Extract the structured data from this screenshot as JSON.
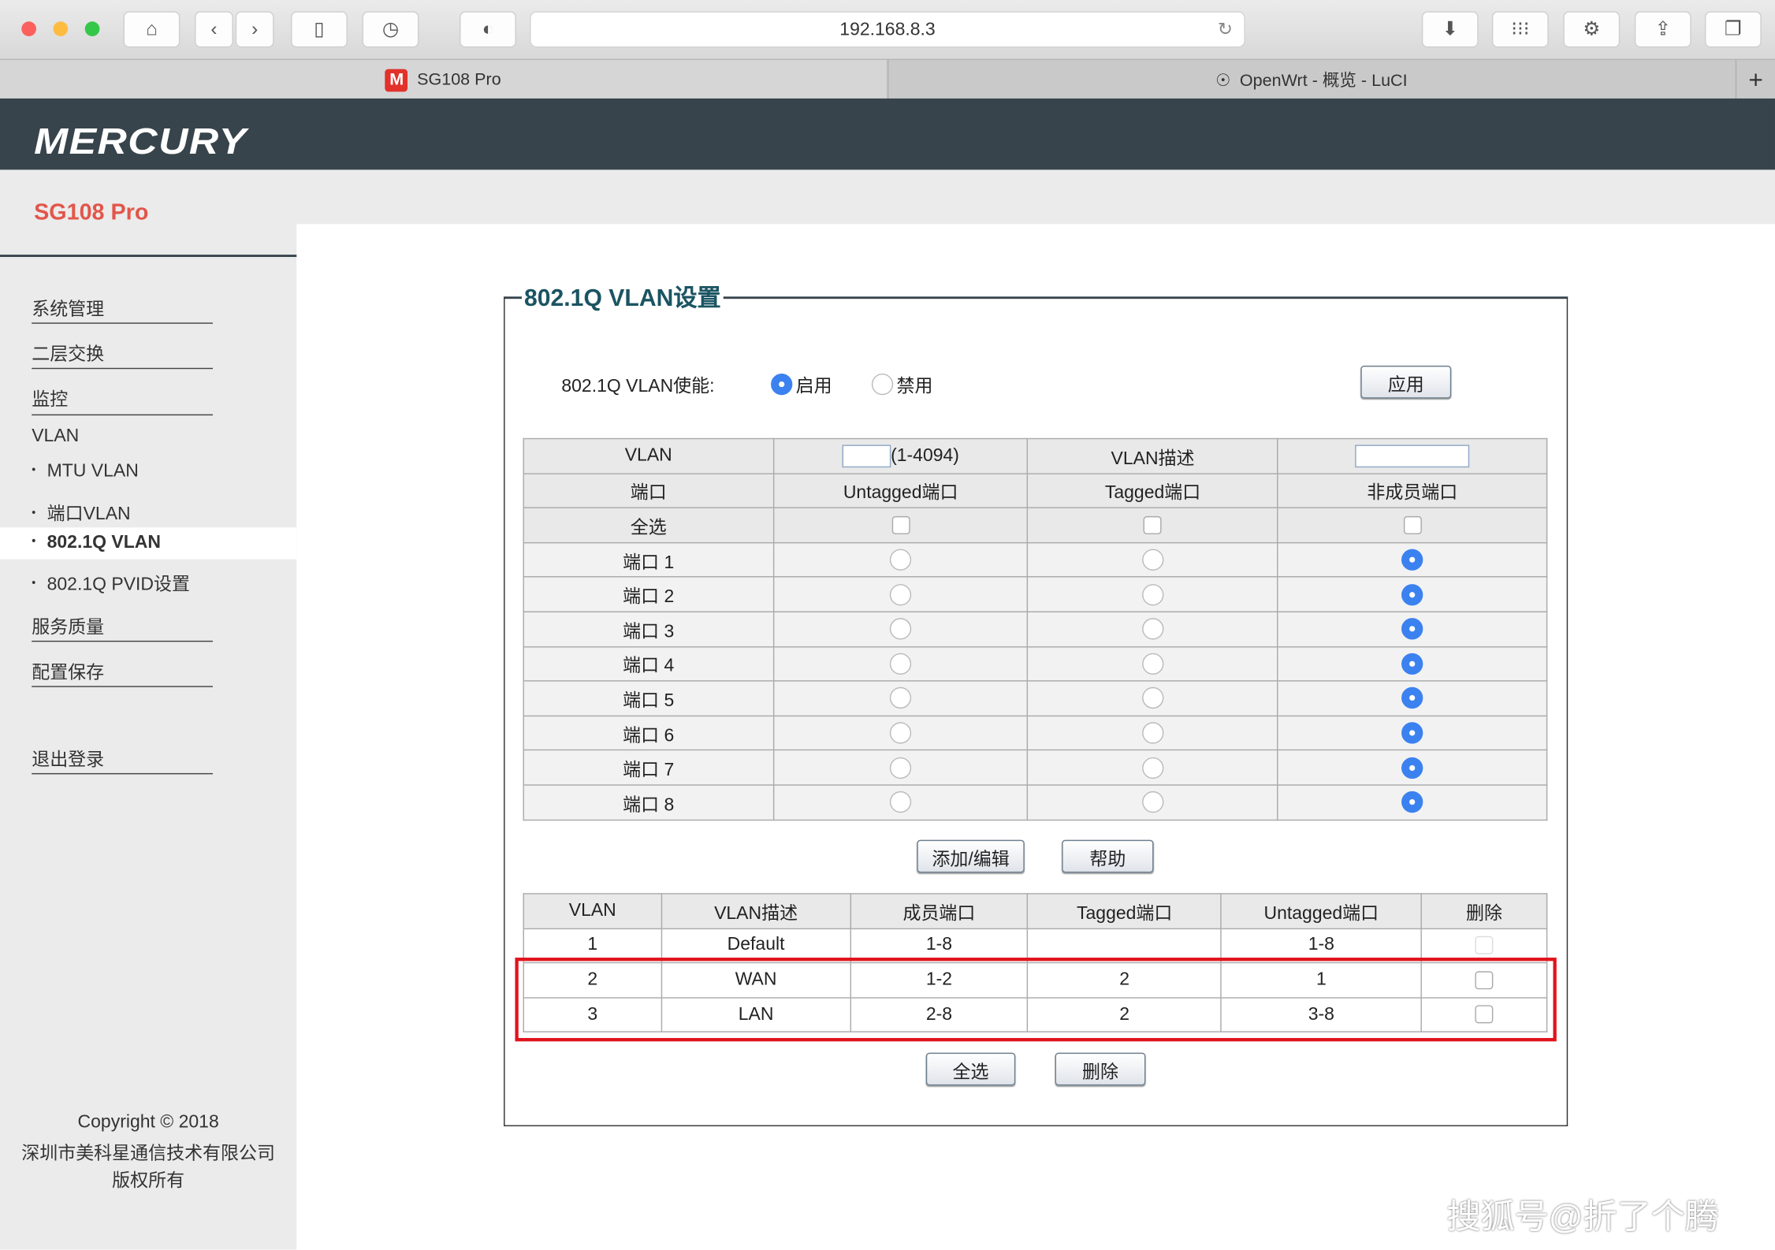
{
  "browser": {
    "url": "192.168.8.3",
    "tabs": [
      {
        "label": "SG108 Pro",
        "active": true
      },
      {
        "label": "OpenWrt - 概览 - LuCI",
        "active": false
      }
    ]
  },
  "header": {
    "logo": "MERCURY",
    "model": "SG108 Pro"
  },
  "sidebar": {
    "items": [
      {
        "label": "系统管理"
      },
      {
        "label": "二层交换"
      },
      {
        "label": "监控"
      },
      {
        "label": "VLAN"
      }
    ],
    "sub": [
      {
        "label": "MTU VLAN"
      },
      {
        "label": "端口VLAN"
      },
      {
        "label": "802.1Q VLAN",
        "active": true
      },
      {
        "label": "802.1Q PVID设置"
      }
    ],
    "items2": [
      {
        "label": "服务质量"
      },
      {
        "label": "配置保存"
      },
      {
        "label": "退出登录"
      }
    ],
    "copyright": [
      "Copyright © 2018",
      "深圳市美科星通信技术有限公司",
      "版权所有"
    ]
  },
  "main": {
    "title": "802.1Q VLAN设置",
    "enable_label": "802.1Q VLAN使能:",
    "enable_on": "启用",
    "enable_off": "禁用",
    "enabled": true,
    "apply": "应用",
    "config": {
      "vlan_label": "VLAN",
      "vlan_id": "",
      "vlan_range": "(1-4094)",
      "desc_label": "VLAN描述",
      "desc": "",
      "headers": [
        "端口",
        "Untagged端口",
        "Tagged端口",
        "非成员端口"
      ],
      "select_all": "全选",
      "ports": [
        {
          "name": "端口 1",
          "mode": "non-member"
        },
        {
          "name": "端口 2",
          "mode": "non-member"
        },
        {
          "name": "端口 3",
          "mode": "non-member"
        },
        {
          "name": "端口 4",
          "mode": "non-member"
        },
        {
          "name": "端口 5",
          "mode": "non-member"
        },
        {
          "name": "端口 6",
          "mode": "non-member"
        },
        {
          "name": "端口 7",
          "mode": "non-member"
        },
        {
          "name": "端口 8",
          "mode": "non-member"
        }
      ]
    },
    "add_edit": "添加/编辑",
    "help": "帮助",
    "list": {
      "headers": [
        "VLAN",
        "VLAN描述",
        "成员端口",
        "Tagged端口",
        "Untagged端口",
        "删除"
      ],
      "rows": [
        [
          "1",
          "Default",
          "1-8",
          "",
          "1-8"
        ],
        [
          "2",
          "WAN",
          "1-2",
          "2",
          "1"
        ],
        [
          "3",
          "LAN",
          "2-8",
          "2",
          "3-8"
        ]
      ]
    },
    "select_all_btn": "全选",
    "delete_btn": "删除"
  },
  "watermark": "搜狐号@折了个腾",
  "colors": {
    "header": "#37444c",
    "model": "#e2564a",
    "highlight": "#e0141c",
    "radio": "#3b82f0"
  }
}
